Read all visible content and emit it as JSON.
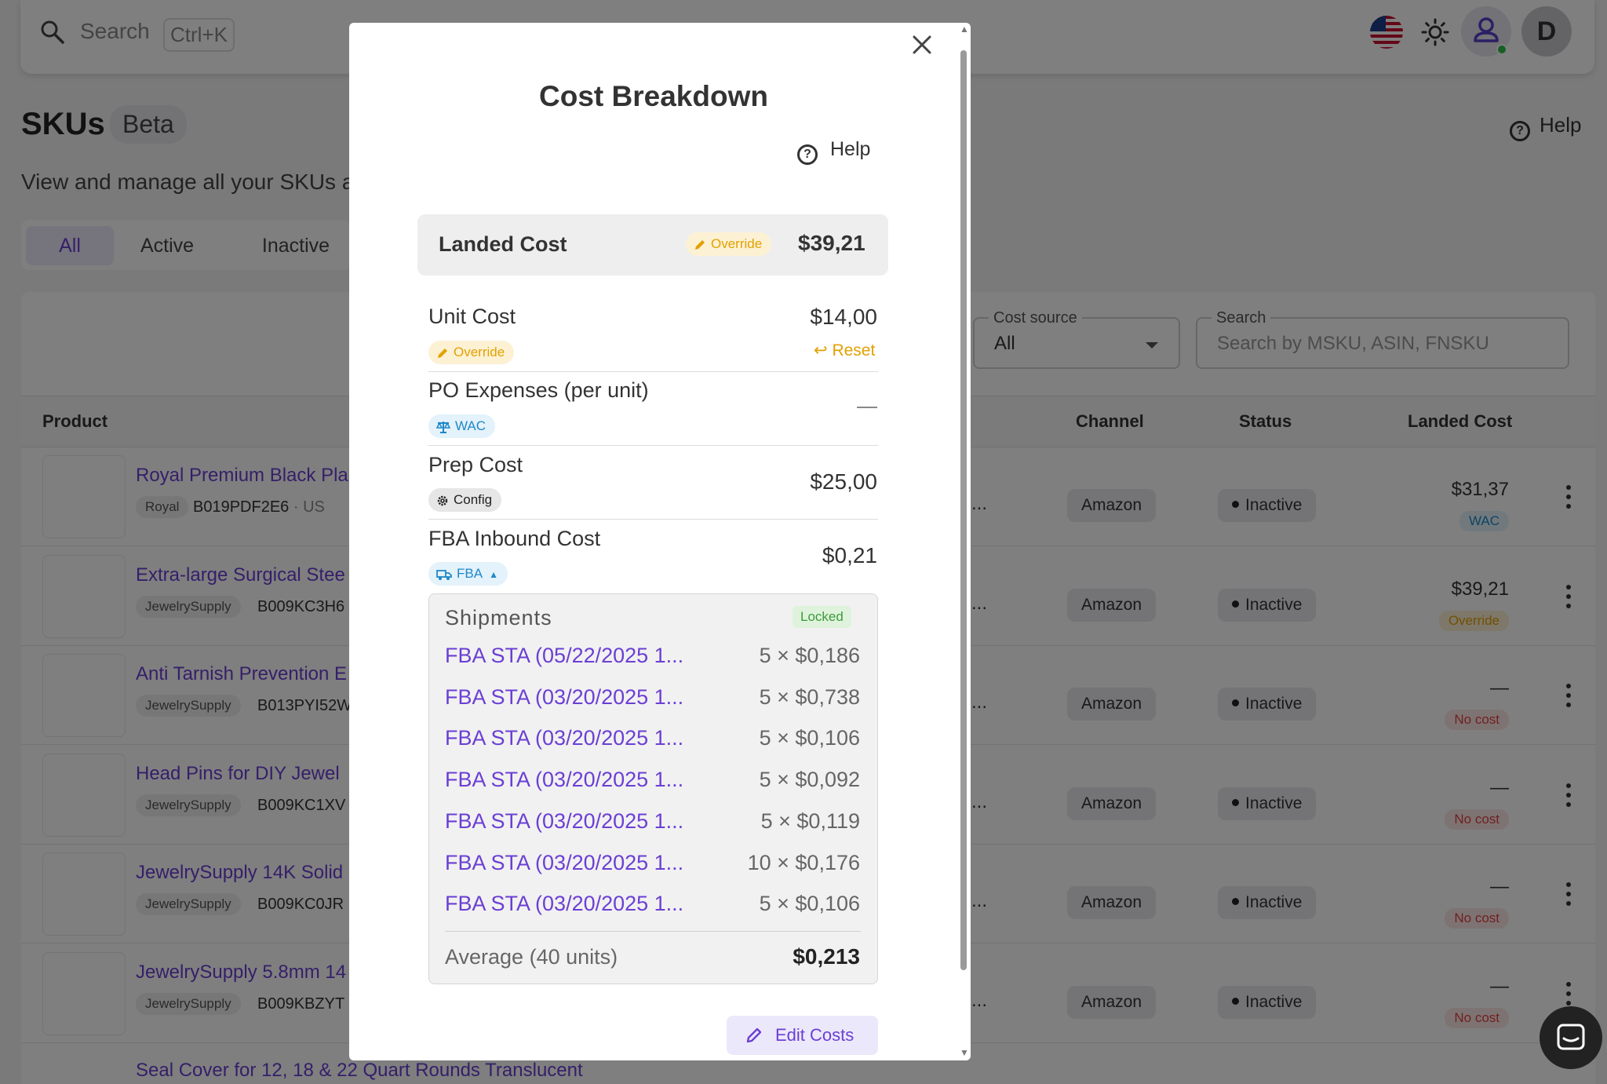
{
  "topbar": {
    "search_placeholder": "Search",
    "shortcut": "Ctrl+K",
    "avatar_letter": "D"
  },
  "page": {
    "title": "SKUs",
    "beta_badge": "Beta",
    "help": "Help",
    "subtitle": "View and manage all your SKUs a"
  },
  "tabs": [
    "All",
    "Active",
    "Inactive"
  ],
  "filters": {
    "cost_source_label": "Cost source",
    "cost_source_value": "All",
    "search_label": "Search",
    "search_placeholder": "Search by MSKU, ASIN, FNSKU"
  },
  "table": {
    "headers": {
      "product": "Product",
      "channel": "Channel",
      "status": "Status",
      "landed_cost": "Landed Cost"
    },
    "rows": [
      {
        "title": "Royal Premium Black Pla",
        "brand": "Royal",
        "sku": "B019PDF2E6",
        "region": "· US",
        "cut": "...",
        "channel": "Amazon",
        "status": "Inactive",
        "landed": "$31,37",
        "badge": "WAC",
        "badge_type": "wac"
      },
      {
        "title": "Extra-large Surgical Stee",
        "brand": "JewelrySupply",
        "sku": "B009KC3H6",
        "region": "",
        "cut": "...",
        "channel": "Amazon",
        "status": "Inactive",
        "landed": "$39,21",
        "badge": "Override",
        "badge_type": "override"
      },
      {
        "title": "Anti Tarnish Prevention E",
        "brand": "JewelrySupply",
        "sku": "B013PYI52W",
        "region": "",
        "cut": "...",
        "channel": "Amazon",
        "status": "Inactive",
        "landed": "—",
        "badge": "No cost",
        "badge_type": "nocost"
      },
      {
        "title": "Head Pins for DIY Jewel",
        "brand": "JewelrySupply",
        "sku": "B009KC1XV",
        "region": "",
        "cut": "...",
        "channel": "Amazon",
        "status": "Inactive",
        "landed": "—",
        "badge": "No cost",
        "badge_type": "nocost"
      },
      {
        "title": "JewelrySupply 14K Solid",
        "brand": "JewelrySupply",
        "sku": "B009KC0JR",
        "region": "",
        "cut": "...",
        "channel": "Amazon",
        "status": "Inactive",
        "landed": "—",
        "badge": "No cost",
        "badge_type": "nocost"
      },
      {
        "title": "JewelrySupply 5.8mm 14",
        "brand": "JewelrySupply",
        "sku": "B009KBZYT",
        "region": "",
        "cut": "...",
        "channel": "Amazon",
        "status": "Inactive",
        "landed": "—",
        "badge": "No cost",
        "badge_type": "nocost"
      }
    ],
    "last_row_title": "Seal Cover for 12, 18 & 22 Quart Rounds Translucent"
  },
  "modal": {
    "title": "Cost Breakdown",
    "help": "Help",
    "landed": {
      "label": "Landed Cost",
      "badge": "Override",
      "value": "$39,21"
    },
    "unit_cost": {
      "label": "Unit Cost",
      "value": "$14,00",
      "badge": "Override",
      "reset": "Reset"
    },
    "po_expenses": {
      "label": "PO Expenses (per unit)",
      "badge": "WAC"
    },
    "prep_cost": {
      "label": "Prep Cost",
      "value": "$25,00",
      "badge": "Config"
    },
    "fba_inbound": {
      "label": "FBA Inbound Cost",
      "value": "$0,21",
      "badge": "FBA"
    },
    "shipments": {
      "title": "Shipments",
      "locked": "Locked",
      "items": [
        {
          "name": "FBA STA (05/22/2025 1...",
          "qty": "5 × $0,186"
        },
        {
          "name": "FBA STA (03/20/2025 1...",
          "qty": "5 × $0,738"
        },
        {
          "name": "FBA STA (03/20/2025 1...",
          "qty": "5 × $0,106"
        },
        {
          "name": "FBA STA (03/20/2025 1...",
          "qty": "5 × $0,092"
        },
        {
          "name": "FBA STA (03/20/2025 1...",
          "qty": "5 × $0,119"
        },
        {
          "name": "FBA STA (03/20/2025 1...",
          "qty": "10 × $0,176"
        },
        {
          "name": "FBA STA (03/20/2025 1...",
          "qty": "5 × $0,106"
        }
      ],
      "average_label": "Average (40 units)",
      "average_value": "$0,213"
    },
    "edit_button": "Edit Costs"
  },
  "colors": {
    "accent": "#6b3fd4",
    "override": "#e2a100",
    "wac": "#1e88c8",
    "nocost": "#e04040",
    "locked": "#3d9a3d"
  }
}
